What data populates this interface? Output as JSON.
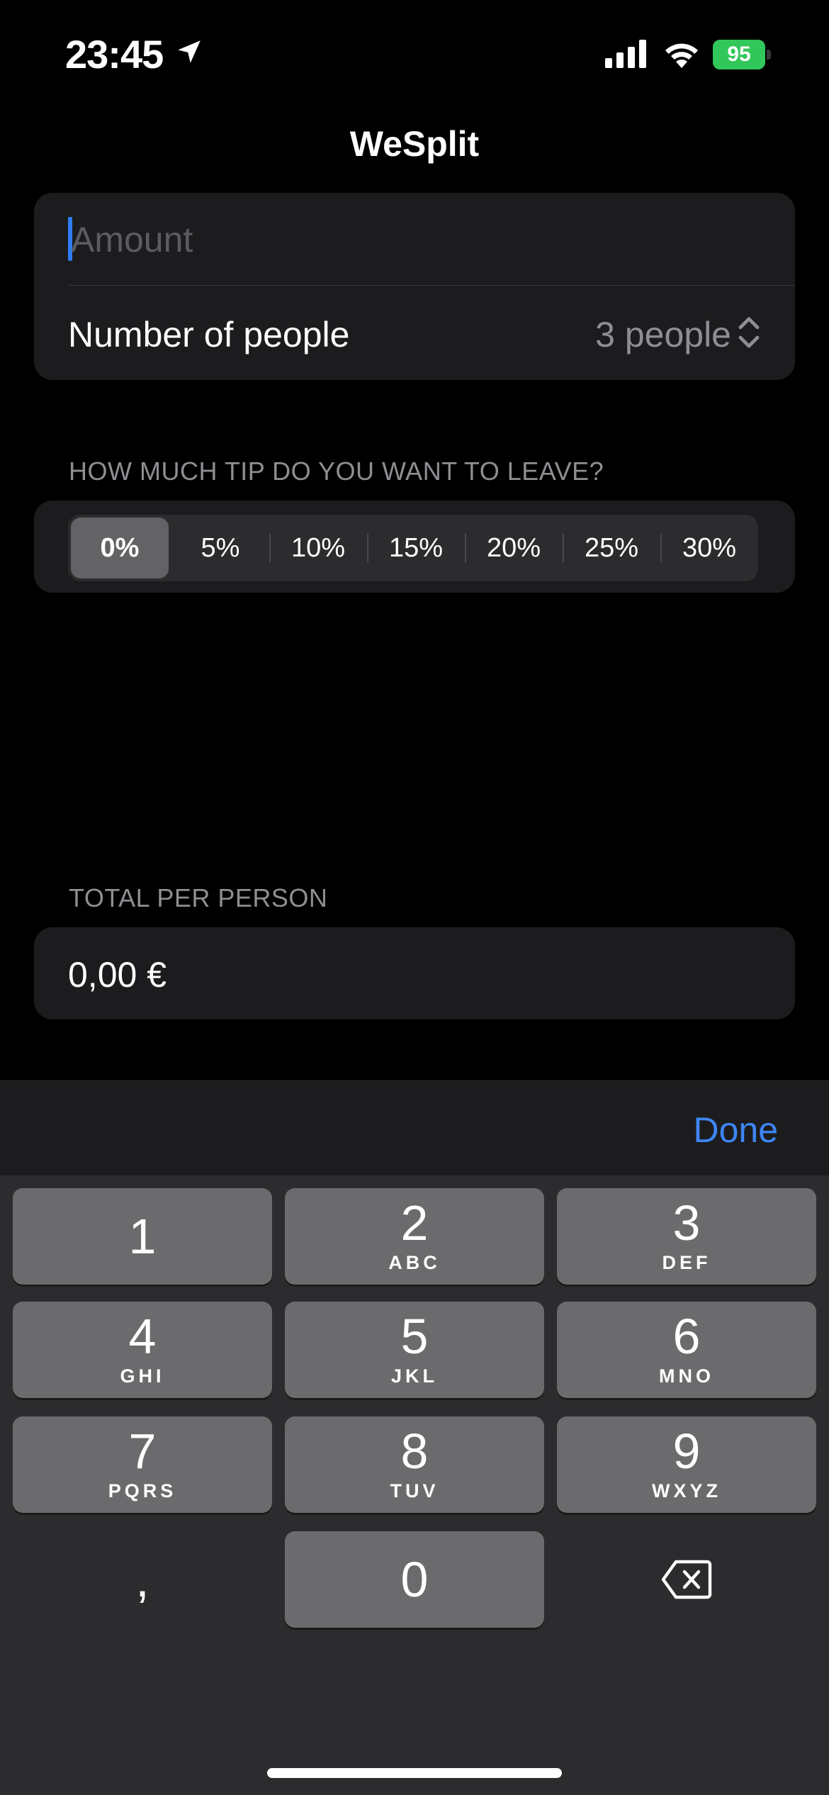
{
  "status_bar": {
    "time": "23:45",
    "battery": "95"
  },
  "nav": {
    "title": "WeSplit"
  },
  "form": {
    "amount_placeholder": "Amount",
    "amount_value": "",
    "people_label": "Number of people",
    "people_value": "3 people"
  },
  "tip_section": {
    "header": "HOW MUCH TIP DO YOU WANT TO LEAVE?",
    "options": [
      "0%",
      "5%",
      "10%",
      "15%",
      "20%",
      "25%",
      "30%"
    ],
    "selected": "0%"
  },
  "total_section": {
    "header": "TOTAL PER PERSON",
    "value": "0,00 €"
  },
  "keyboard": {
    "done_label": "Done",
    "keys": [
      {
        "digit": "1",
        "letters": ""
      },
      {
        "digit": "2",
        "letters": "ABC"
      },
      {
        "digit": "3",
        "letters": "DEF"
      },
      {
        "digit": "4",
        "letters": "GHI"
      },
      {
        "digit": "5",
        "letters": "JKL"
      },
      {
        "digit": "6",
        "letters": "MNO"
      },
      {
        "digit": "7",
        "letters": "PQRS"
      },
      {
        "digit": "8",
        "letters": "TUV"
      },
      {
        "digit": "9",
        "letters": "WXYZ"
      },
      {
        "digit": "0",
        "letters": ""
      }
    ],
    "comma": ",",
    "delete_icon": "backspace-icon"
  },
  "colors": {
    "accent": "#3d86f6",
    "background": "#000000",
    "card": "#1c1c1e",
    "battery": "#32c75a"
  }
}
